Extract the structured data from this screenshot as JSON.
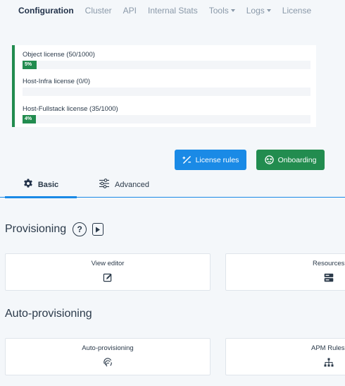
{
  "nav": {
    "items": [
      {
        "label": "Configuration",
        "active": true
      },
      {
        "label": "Cluster"
      },
      {
        "label": "API"
      },
      {
        "label": "Internal Stats"
      },
      {
        "label": "Tools",
        "dropdown": true
      },
      {
        "label": "Logs",
        "dropdown": true
      },
      {
        "label": "License"
      }
    ]
  },
  "licenses": [
    {
      "label": "Object license (50/1000)",
      "percent_label": "5%",
      "fraction": 0.05
    },
    {
      "label": "Host-Infra license (0/0)",
      "percent_label": "",
      "fraction": 0
    },
    {
      "label": "Host-Fullstack license (35/1000)",
      "percent_label": "4%",
      "fraction": 0.035
    }
  ],
  "buttons": {
    "license_rules": "License rules",
    "onboarding": "Onboarding"
  },
  "tabs": {
    "basic": "Basic",
    "advanced": "Advanced"
  },
  "sections": {
    "provisioning": "Provisioning",
    "help_glyph": "?",
    "auto_provisioning": "Auto-provisioning"
  },
  "tiles": {
    "view_editor": "View editor",
    "resources": "Resources",
    "auto_provisioning": "Auto-provisioning",
    "apm_rules": "APM Rules"
  },
  "colors": {
    "accent": "#1a8ae6",
    "success": "#228c4f",
    "text": "#2b3a4a",
    "muted": "#8a99a9"
  }
}
